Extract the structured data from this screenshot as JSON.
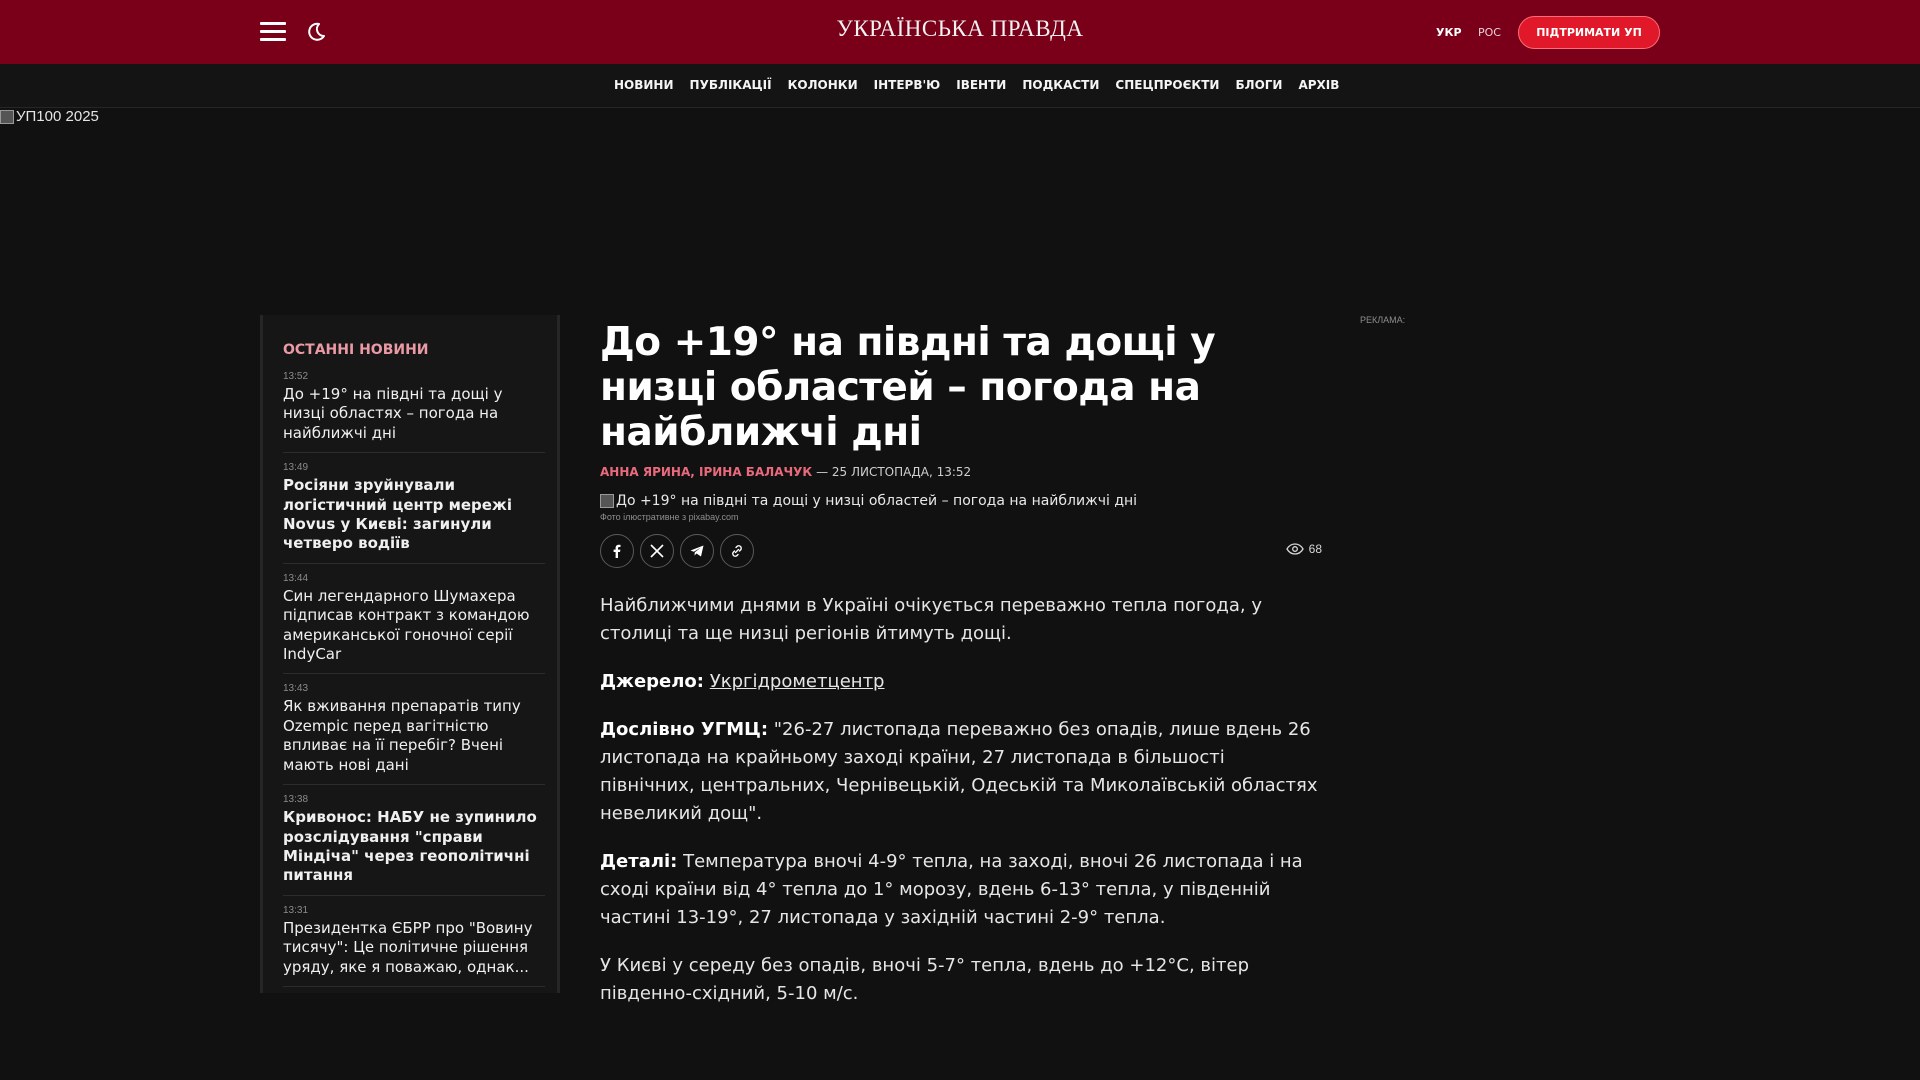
{
  "header": {
    "logo": "УКРАЇНСЬКА ПРАВДА",
    "lang_ukr": "УКР",
    "lang_ros": "РОС",
    "support_label": "ПІДТРИМАТИ УП",
    "brand_color": "#7a0019",
    "accent_color": "#e0182a"
  },
  "nav": {
    "items": [
      "НОВИНИ",
      "ПУБЛІКАЦІЇ",
      "КОЛОНКИ",
      "ІНТЕРВ'Ю",
      "ІВЕНТИ",
      "ПОДКАСТИ",
      "СПЕЦПРОЄКТИ",
      "БЛОГИ",
      "АРХІВ"
    ]
  },
  "banner": {
    "alt": "УП100 2025"
  },
  "sidebar": {
    "title": "ОСТАННІ НОВИНИ",
    "items": [
      {
        "time": "13:52",
        "text": "До +19° на півдні та дощі у низці областях – погода на найближчі дні",
        "bold": false
      },
      {
        "time": "13:49",
        "text": "Росіяни зруйнували логістичний центр мережі Novus у Києві: загинули четверо водіїв",
        "bold": true
      },
      {
        "time": "13:44",
        "text": "Син легендарного Шумахера підписав контракт з командою американської гоночної серії IndyCar",
        "bold": false
      },
      {
        "time": "13:43",
        "text": "Як вживання препаратів типу Ozempic перед вагітністю впливає на її перебіг? Вчені мають нові дані",
        "bold": false
      },
      {
        "time": "13:38",
        "text": "Кривонос: НАБУ не зупинило розслідування \"справи Міндіча\" через геополітичні питання",
        "bold": true
      },
      {
        "time": "13:31",
        "text": "Президентка ЄБРР про \"Вовину тисячу\": Це політичне рішення уряду, яке я поважаю, однак...",
        "bold": false
      }
    ]
  },
  "article": {
    "title": "До +19° на півдні та дощі у низці областей – погода на найближчі дні",
    "authors": "АННА ЯРИНА, ІРИНА БАЛАЧУК",
    "date": "— 25 ЛИСТОПАДА, 13:52",
    "photo_alt": "До +19° на півдні та дощі у низці областей – погода на найближчі дні",
    "photo_credit": "Фото ілюстративне з pixabay.com",
    "views": "68",
    "share_icons": [
      "facebook-icon",
      "x-icon",
      "telegram-icon",
      "link-icon"
    ],
    "lead": "Найближчими днями в Україні очікується переважно тепла погода, у столиці та ще низці регіонів йтимуть дощі.",
    "source_label": "Джерело:",
    "source_link": "Укргідрометцентр",
    "quote_label": "Дослівно УГМЦ:",
    "quote_text": "\"26-27 листопада переважно без опадів, лише вдень 26 листопада на крайньому заході країни, 27 листопада в більшості північних, центральних, Чернівецькій, Одеській та Миколаївській областях невеликий дощ\".",
    "details_label": "Деталі:",
    "details_text": "Температура вночі 4-9° тепла, на заході, вночі 26 листопада і на сході країни від 4° тепла до 1° морозу, вдень 6-13° тепла, у південній частині 13-19°, 27 листопада у західній частині 2-9° тепла.",
    "kyiv_text": "У Києві у середу без опадів, вночі 5-7° тепла, вдень до +12°С, вітер південно-східний, 5-10 м/с."
  },
  "ad": {
    "label": "РЕКЛАМА:"
  }
}
